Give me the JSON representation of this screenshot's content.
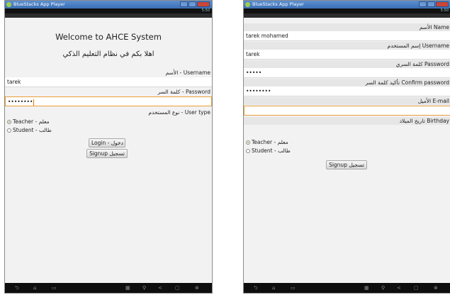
{
  "window": {
    "title": "BlueStacks App Player",
    "status_clock": "5:50"
  },
  "login": {
    "welcome": "Welcome to AHCE System",
    "welcome_ar": "اهلا بكم في نظام التعليم الذكي",
    "username_label": "Username - الأسم",
    "username_value": "tarek",
    "password_label": "Password - كلمة السر",
    "password_value": "••••••••",
    "usertype_label": "User type - نوع المستخدم",
    "teacher_option": "Teacher - معلم",
    "student_option": "Student - طالب",
    "login_button": "Login - دخول",
    "signup_button": "Signup تسجيل",
    "selected_type": "Teacher"
  },
  "signup": {
    "name_label": "Name الأسم",
    "name_value": "tarek mohamed",
    "username_label": "Username إسم المستخدم",
    "username_value": "tarek",
    "password_label": "Password كلمة السري",
    "password_value": "•••••",
    "confirm_label": "Confirm password تأكيد كلمة السر",
    "confirm_value": "••••••••",
    "email_label": "E-mail الأميل",
    "email_value": "",
    "birthday_label": "Birthday تاريخ الميلاد",
    "teacher_option": "Teacher - معلم",
    "student_option": "Student - طالب",
    "signup_button": "Signup تسجيل",
    "selected_type": "Teacher"
  },
  "icons": [
    "back-icon",
    "home-icon",
    "recent-apps-icon",
    "keyboard-icon",
    "location-icon",
    "share-icon",
    "screen-icon",
    "close-icon"
  ]
}
